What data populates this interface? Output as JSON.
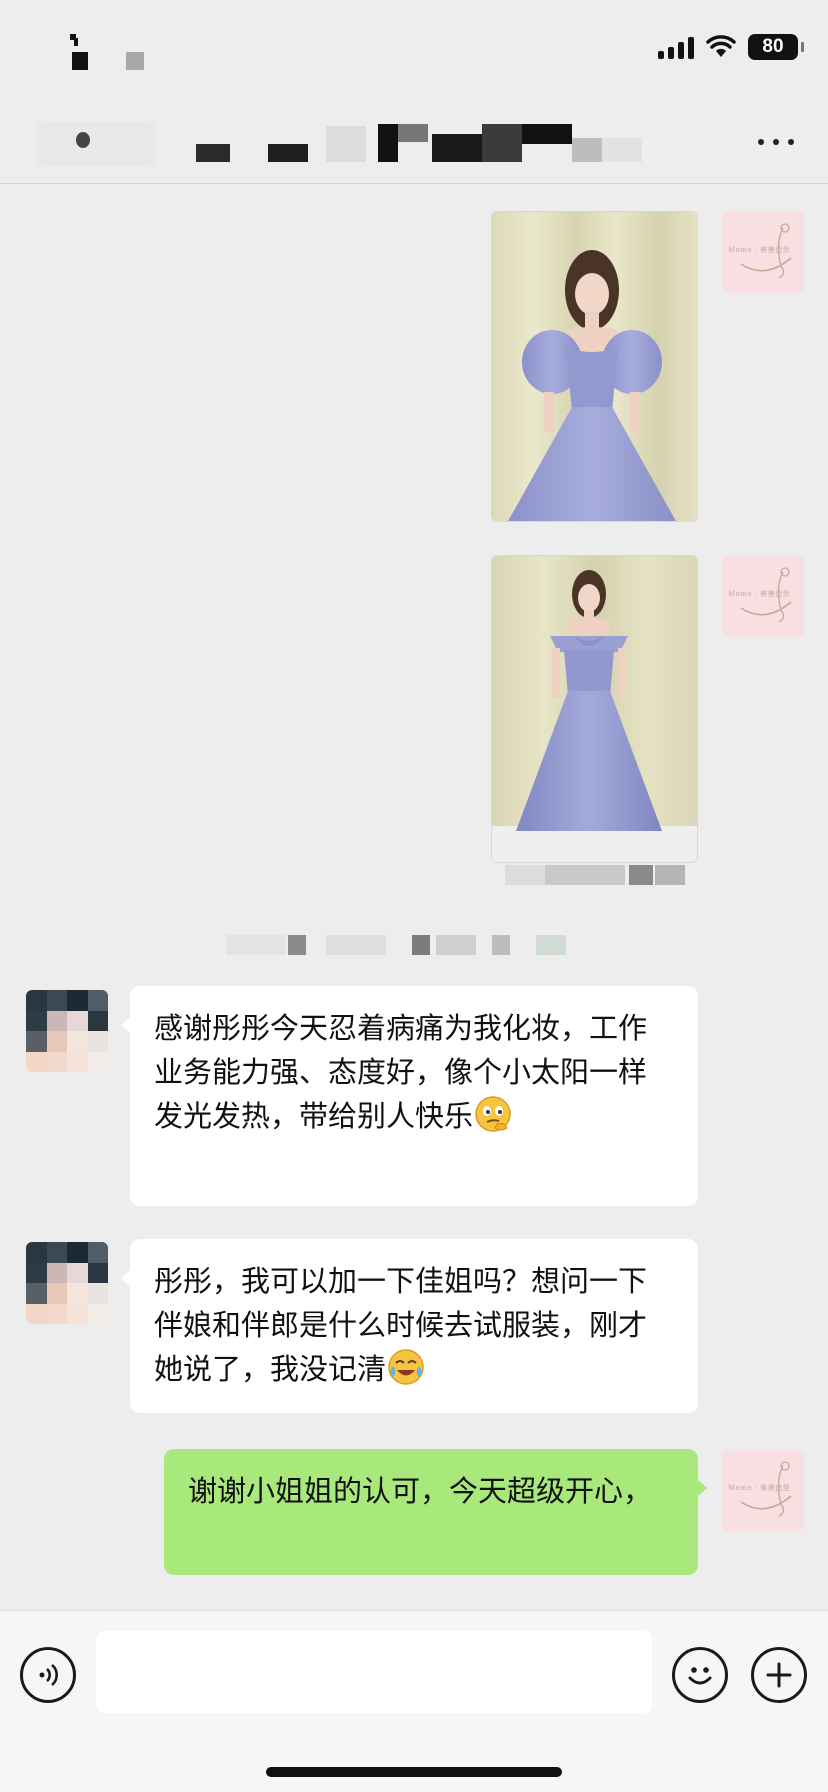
{
  "status_bar": {
    "battery": "80",
    "icons": [
      "signal-icon",
      "wifi-icon",
      "battery-icon"
    ]
  },
  "nav": {
    "title": "",
    "more_icon": "more-dots-icon"
  },
  "messages": [
    {
      "side": "self",
      "type": "image",
      "subject": "woman in lavender puff-sleeve ball gown"
    },
    {
      "side": "self",
      "type": "image",
      "subject": "woman in lavender off-shoulder bow gown"
    },
    {
      "side": "other",
      "type": "text",
      "text": "感谢彤彤今天忍着病痛为我化妆，工作业务能力强、态度好，像个小太阳一样发光发热，带给别人快乐",
      "emoji": "thinking-face-emoji"
    },
    {
      "side": "other",
      "type": "text",
      "text": "彤彤，我可以加一下佳姐吗？想问一下伴娘和伴郎是什么时候去试服装，刚才她说了，我没记清",
      "emoji": "tears-of-joy-emoji"
    },
    {
      "side": "self",
      "type": "text",
      "text": "谢谢小姐姐的认可，今天超级开心，"
    }
  ],
  "input_bar": {
    "placeholder": "",
    "icons": [
      "voice-icon",
      "emoji-icon",
      "plus-icon"
    ]
  },
  "colors": {
    "background": "#ededed",
    "bubble_self": "#a9e97b",
    "bubble_other": "#ffffff",
    "avatar_self_bg": "#f7dfe2"
  }
}
